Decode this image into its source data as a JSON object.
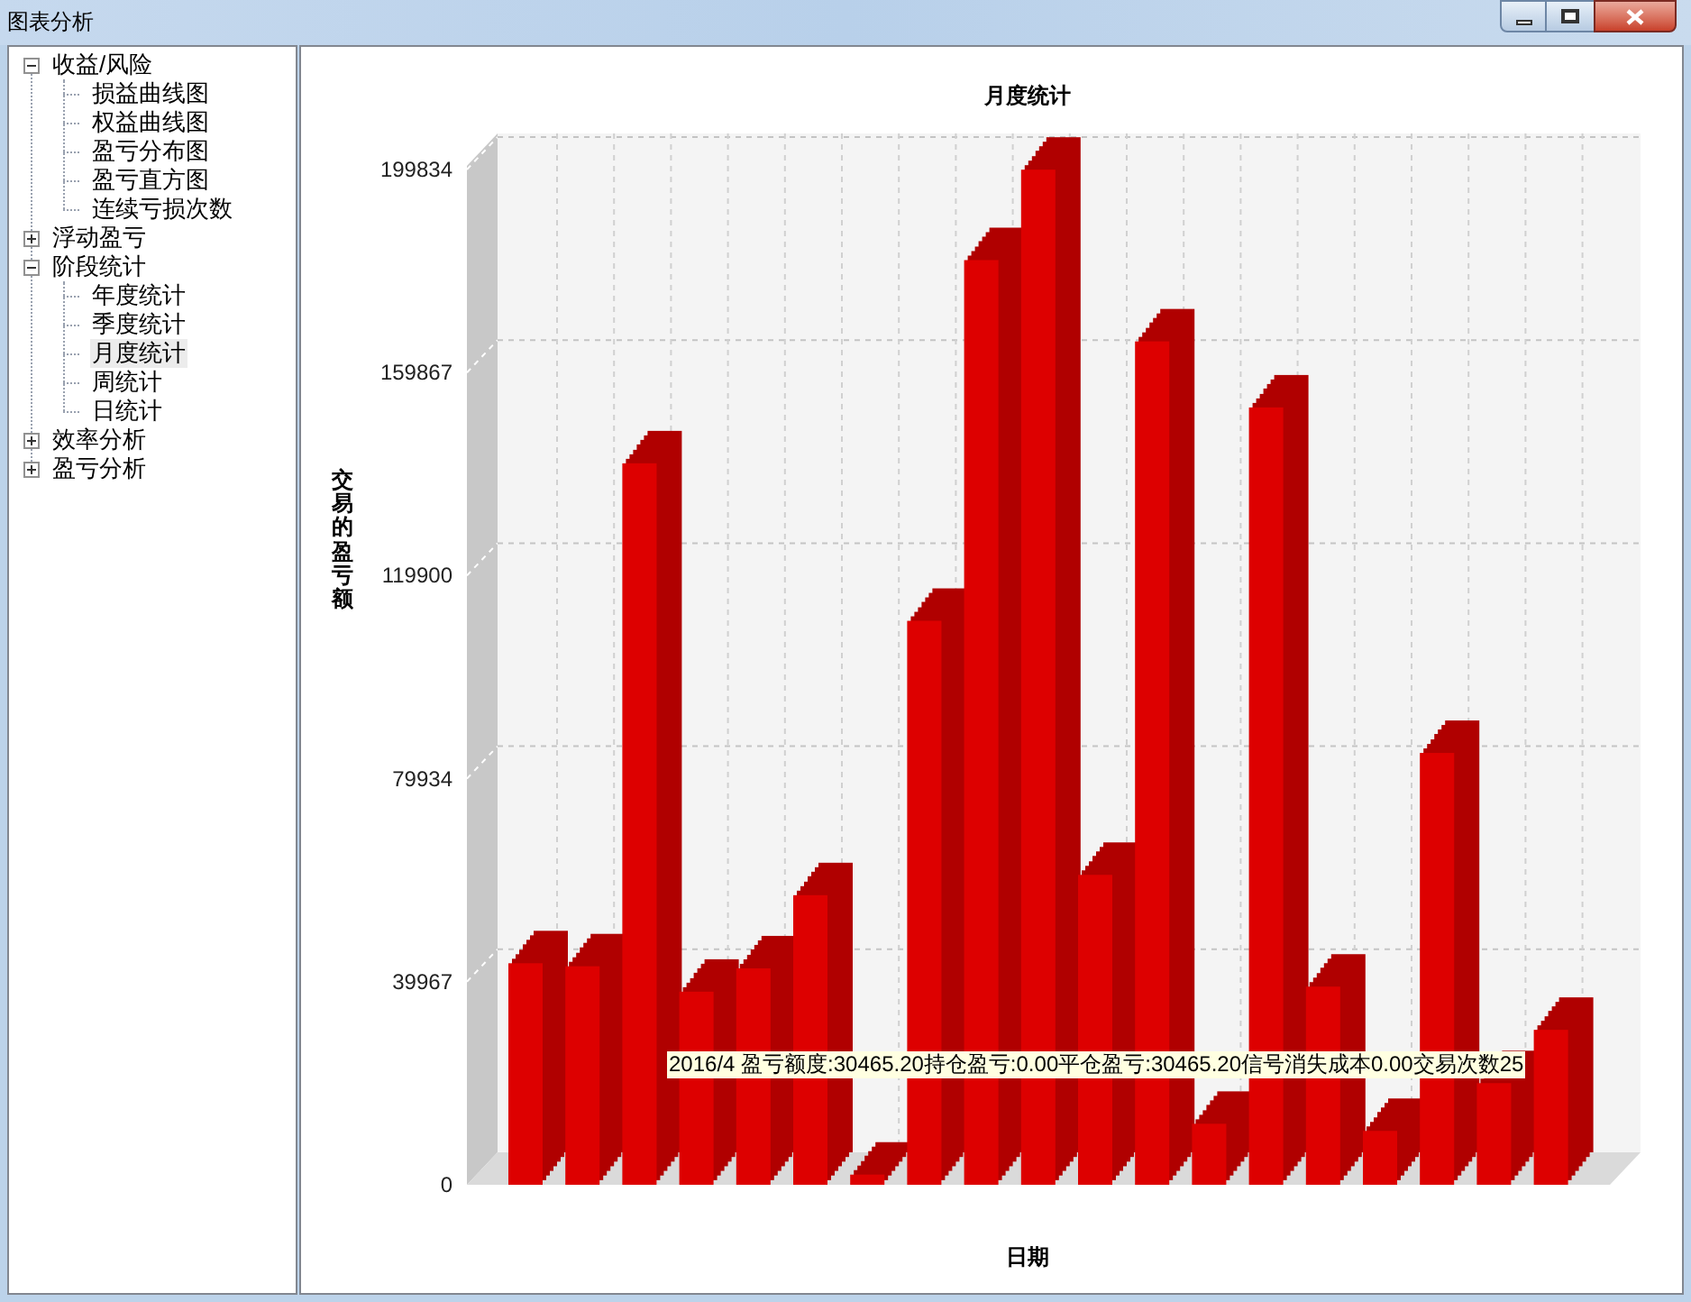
{
  "window": {
    "title": "图表分析"
  },
  "tree": [
    {
      "label": "收益/风险",
      "expanded": true,
      "selected": false,
      "children": [
        {
          "label": "损益曲线图",
          "selected": false
        },
        {
          "label": "权益曲线图",
          "selected": false
        },
        {
          "label": "盈亏分布图",
          "selected": false
        },
        {
          "label": "盈亏直方图",
          "selected": false
        },
        {
          "label": "连续亏损次数",
          "selected": false
        }
      ]
    },
    {
      "label": "浮动盈亏",
      "expanded": false,
      "selected": false
    },
    {
      "label": "阶段统计",
      "expanded": true,
      "selected": false,
      "children": [
        {
          "label": "年度统计",
          "selected": false
        },
        {
          "label": "季度统计",
          "selected": false
        },
        {
          "label": "月度统计",
          "selected": true
        },
        {
          "label": "周统计",
          "selected": false
        },
        {
          "label": "日统计",
          "selected": false
        }
      ]
    },
    {
      "label": "效率分析",
      "expanded": false,
      "selected": false
    },
    {
      "label": "盈亏分析",
      "expanded": false,
      "selected": false
    }
  ],
  "chart": {
    "tooltip": "2016/4 盈亏额度:30465.20持仓盈亏:0.00平仓盈亏:30465.20信号消失成本0.00交易次数25",
    "chart_data": {
      "type": "bar",
      "title": "月度统计",
      "xlabel": "日期",
      "ylabel": "交易的盈亏额",
      "ylim": [
        0,
        199834
      ],
      "yticks": [
        0,
        39967,
        79934,
        119900,
        159867,
        199834
      ],
      "grid": true,
      "series": [
        {
          "color": "#dd0000",
          "values": [
            43600,
            43000,
            142000,
            38000,
            42600,
            57000,
            2000,
            111000,
            182000,
            199800,
            61000,
            166000,
            12000,
            153000,
            39000,
            10600,
            85000,
            20000,
            30500
          ]
        }
      ]
    }
  }
}
